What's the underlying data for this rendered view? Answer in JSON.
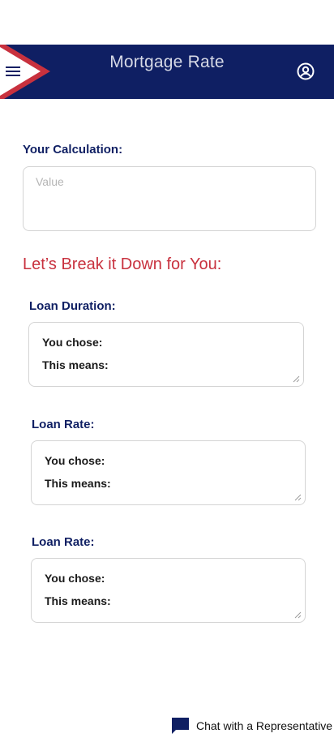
{
  "header": {
    "title": "Mortgage Rate",
    "background_color": "#0f1f63",
    "accent_color": "#c8313e",
    "icons": {
      "menu": "hamburger-menu-icon",
      "account": "user-circle-icon"
    }
  },
  "calculation": {
    "label": "Your Calculation:",
    "placeholder": "Value"
  },
  "breakdown": {
    "title": "Let’s Break it Down for You:",
    "sections": [
      {
        "label": "Loan Duration:",
        "chose": "You chose:",
        "means": "This means:"
      },
      {
        "label": "Loan Rate:",
        "chose": "You chose:",
        "means": "This means:"
      },
      {
        "label": "Loan Rate:",
        "chose": "You chose:",
        "means": "This means:"
      }
    ]
  },
  "chat": {
    "label": "Chat with a Representative",
    "icon": "chat-bubble-icon"
  }
}
